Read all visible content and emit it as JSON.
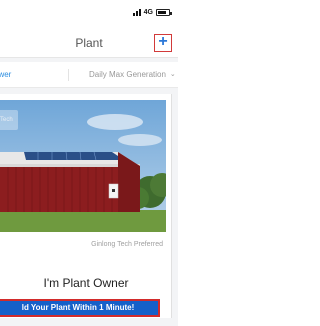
{
  "status_bar": {
    "network": "4G"
  },
  "header": {
    "title": "Plant",
    "add_label": "+"
  },
  "filters": {
    "left_label": "ower",
    "right_label": "Daily Max Generation",
    "right_chevron": "⌄"
  },
  "card": {
    "photo_badge": "Tech",
    "caption": "Ginlong Tech Preferred",
    "title": "I'm Plant Owner",
    "button_label": "ld Your Plant Within 1 Minute!"
  },
  "colors": {
    "accent": "#1560c9",
    "link": "#2b8de0",
    "highlight_border": "#d22b2b"
  }
}
